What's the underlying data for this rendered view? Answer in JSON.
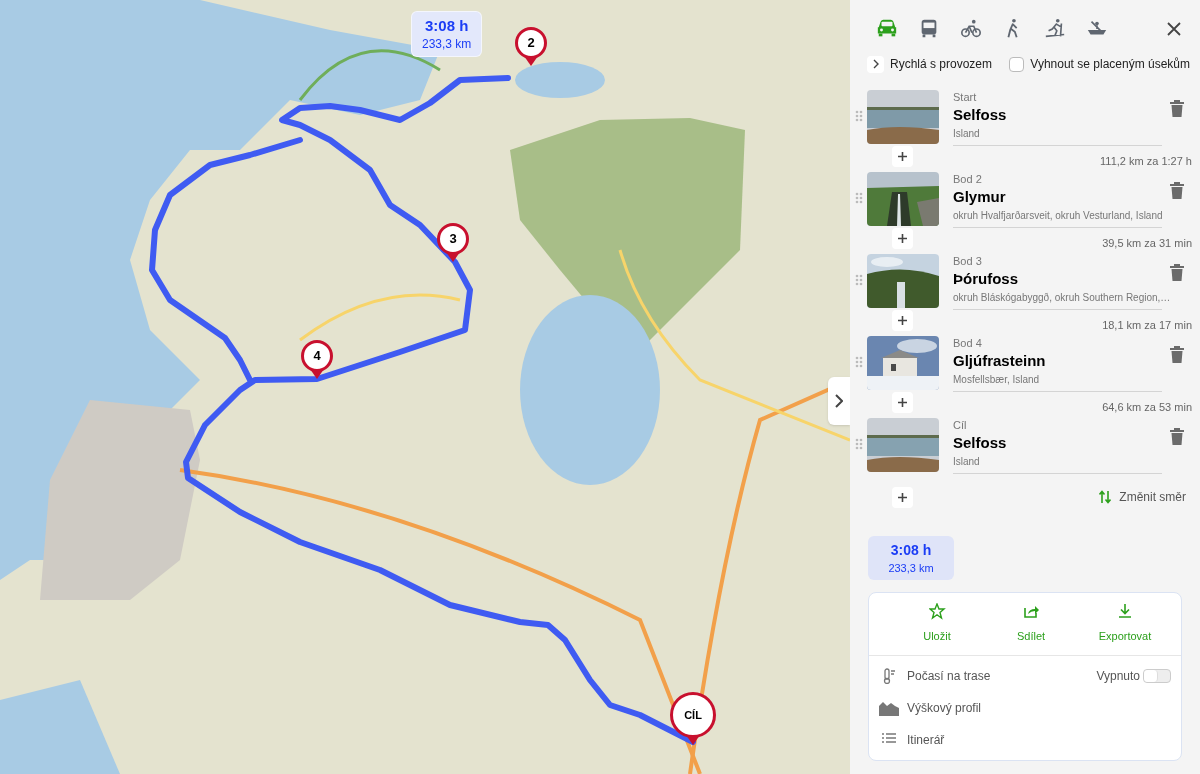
{
  "map": {
    "route_bubble": {
      "time": "3:08 h",
      "distance": "233,3 km"
    },
    "markers": [
      {
        "kind": "via",
        "label": "2"
      },
      {
        "kind": "via",
        "label": "3"
      },
      {
        "kind": "via",
        "label": "4"
      },
      {
        "kind": "end",
        "label": "CÍL"
      }
    ]
  },
  "panel": {
    "modes": [
      {
        "kind": "car",
        "selected": true
      },
      {
        "kind": "bus",
        "selected": false
      },
      {
        "kind": "bike",
        "selected": false
      },
      {
        "kind": "walk",
        "selected": false
      },
      {
        "kind": "ski",
        "selected": false
      },
      {
        "kind": "boat",
        "selected": false
      }
    ],
    "route_type": "Rychlá s provozem",
    "avoid_tolls": {
      "label": "Vyhnout se placeným úsekům",
      "checked": false
    },
    "waypoints": [
      {
        "label": "Start",
        "name": "Selfoss",
        "place": "Island",
        "leg": "111,2 km za 1:27 h"
      },
      {
        "label": "Bod 2",
        "name": "Glymur",
        "place": "okruh Hvalfjarðarsveit, okruh Vesturland, Island",
        "leg": "39,5 km za 31 min"
      },
      {
        "label": "Bod 3",
        "name": "Þórufoss",
        "place": "okruh Bláskógabyggð, okruh Southern Region,…",
        "leg": "18,1 km za 17 min"
      },
      {
        "label": "Bod 4",
        "name": "Gljúfrasteinn",
        "place": "Mosfellsbær, Island",
        "leg": "64,6 km za 53 min"
      },
      {
        "label": "Cíl",
        "name": "Selfoss",
        "place": "Island"
      }
    ],
    "reverse": "Změnit směr",
    "summary": {
      "time": "3:08 h",
      "distance": "233,3 km"
    },
    "actions": [
      {
        "kind": "save",
        "label": "Uložit"
      },
      {
        "kind": "share",
        "label": "Sdílet"
      },
      {
        "kind": "export",
        "label": "Exportovat"
      }
    ],
    "tools": [
      {
        "kind": "weather",
        "label": "Počasí na trase",
        "toggle": {
          "label": "Vypnuto",
          "on": false
        }
      },
      {
        "kind": "elevation",
        "label": "Výškový profil"
      },
      {
        "kind": "itinerary",
        "label": "Itinerář"
      }
    ]
  }
}
